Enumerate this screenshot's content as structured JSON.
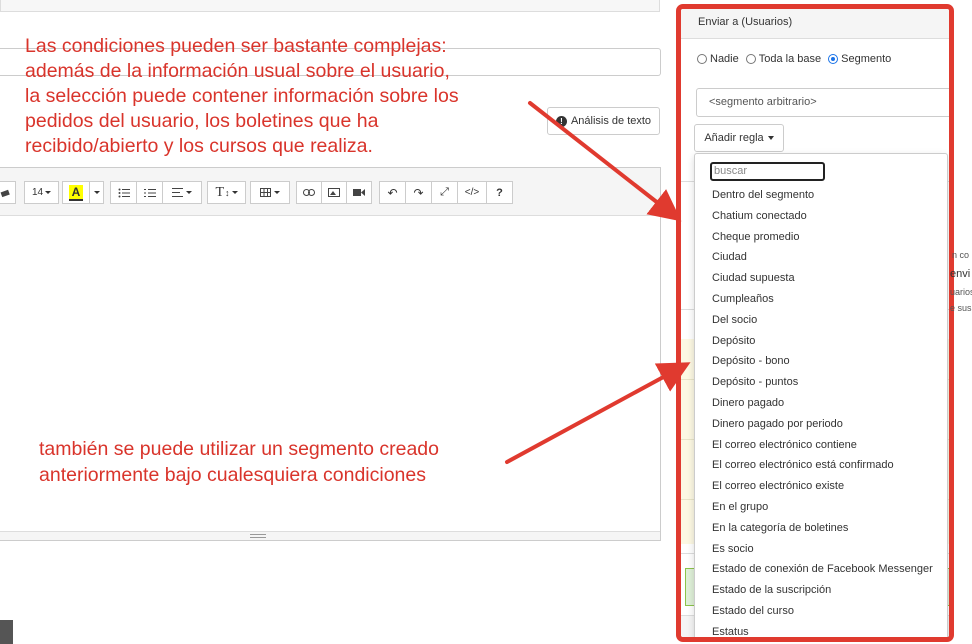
{
  "annotations": {
    "top": [
      "Las condiciones pueden ser bastante complejas:",
      "además de la información usual sobre el usuario,",
      "la selección puede contener información sobre los",
      "pedidos del usuario, los boletines que ha",
      "recibido/abierto y los cursos que realiza."
    ],
    "bottom": [
      "también se puede utilizar un segmento creado",
      "anteriormente bajo cualesquiera condiciones"
    ],
    "color": "#d9342b"
  },
  "editor": {
    "analysis_button": "Análisis de texto",
    "font_size": "14",
    "highlight_label": "A",
    "heading_label": "T",
    "help_label": "?",
    "code_label": "</>"
  },
  "panel": {
    "header": "Enviar a (Usuarios)",
    "radio_options": [
      {
        "label": "Nadie",
        "checked": false
      },
      {
        "label": "Toda la base",
        "checked": false
      },
      {
        "label": "Segmento",
        "checked": true
      }
    ],
    "segment_select": "<segmento arbitrario>",
    "add_rule_button": "Añadir regla",
    "border_color": "#e03a2f",
    "dropdown": {
      "search_placeholder": "buscar",
      "items": [
        "Dentro del segmento",
        "Chatium conectado",
        "Cheque promedio",
        "Ciudad",
        "Ciudad supuesta",
        "Cumpleaños",
        "Del socio",
        "Depósito",
        "Depósito - bono",
        "Depósito - puntos",
        "Dinero pagado",
        "Dinero pagado por periodo",
        "El correo electrónico contiene",
        "El correo electrónico está confirmado",
        "El correo electrónico existe",
        "En el grupo",
        "En la categoría de boletines",
        "Es socio",
        "Estado de conexión de Facebook Messenger",
        "Estado de la suscripción",
        "Estado del curso",
        "Estatus"
      ]
    },
    "edge_fragments": [
      "n co",
      "envi",
      "uarios",
      "e sus"
    ]
  }
}
